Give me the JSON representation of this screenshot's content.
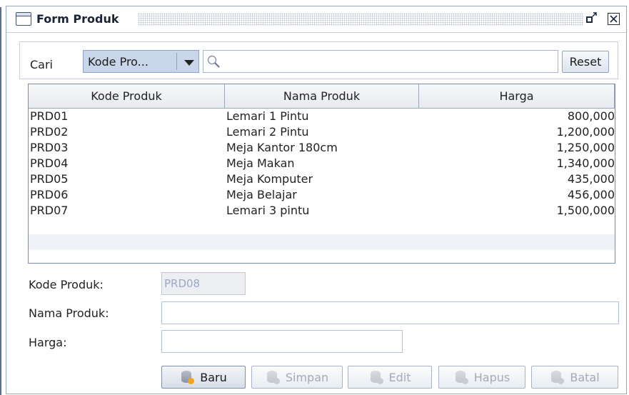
{
  "window": {
    "title": "Form Produk",
    "restore_icon": "restore-icon",
    "close_icon": "close-icon"
  },
  "search": {
    "label": "Cari",
    "combo_value": "Kode Pro...",
    "query": "",
    "reset_label": "Reset"
  },
  "table": {
    "headers": [
      "Kode Produk",
      "Nama Produk",
      "Harga"
    ],
    "rows": [
      {
        "kode": "PRD01",
        "nama": "Lemari 1 Pintu",
        "harga": "800,000"
      },
      {
        "kode": "PRD02",
        "nama": "Lemari 2 Pintu",
        "harga": "1,200,000"
      },
      {
        "kode": "PRD03",
        "nama": "Meja Kantor 180cm",
        "harga": "1,250,000"
      },
      {
        "kode": "PRD04",
        "nama": "Meja Makan",
        "harga": "1,340,000"
      },
      {
        "kode": "PRD05",
        "nama": "Meja Komputer",
        "harga": "435,000"
      },
      {
        "kode": "PRD06",
        "nama": "Meja Belajar",
        "harga": "456,000"
      },
      {
        "kode": "PRD07",
        "nama": "Lemari 3 pintu",
        "harga": "1,500,000"
      }
    ]
  },
  "form": {
    "kode_label": "Kode Produk:",
    "kode_value": "PRD08",
    "nama_label": "Nama Produk:",
    "nama_value": "",
    "harga_label": "Harga:",
    "harga_value": ""
  },
  "actions": {
    "baru": "Baru",
    "simpan": "Simpan",
    "edit": "Edit",
    "hapus": "Hapus",
    "batal": "Batal"
  },
  "colors": {
    "accent": "#c9d6ea",
    "disabled_text": "#a4aab6"
  }
}
